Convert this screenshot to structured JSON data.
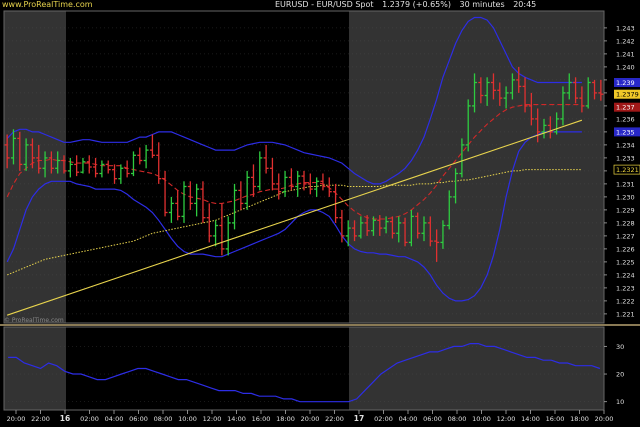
{
  "header": {
    "site": "www.ProRealTime.com",
    "instrument": "EURUSD - EUR/USD Spot",
    "price_change": "1.2379 (+0.65%)",
    "timeframe": "30 minutes",
    "time": "20:45"
  },
  "watermark": "© ProRealTime.com",
  "colors": {
    "up": "#2ecc40",
    "down": "#e03030",
    "bollinger": "#2d2de6",
    "ma": "#e8d44d",
    "trendline": "#e8d44d",
    "indicator": "#2d2de6",
    "mid_band": "#d02828",
    "grid": "#555555",
    "text": "#e0e0e0"
  },
  "chart_data": [
    {
      "type": "candlestick",
      "x_ticks": [
        "20:00",
        "22:00",
        "16",
        "02:00",
        "04:00",
        "06:00",
        "08:00",
        "10:00",
        "12:00",
        "14:00",
        "16:00",
        "18:00",
        "20:00",
        "22:00",
        "17",
        "02:00",
        "04:00",
        "06:00",
        "08:00",
        "10:00",
        "12:00",
        "14:00",
        "16:00",
        "18:00",
        "20:00"
      ],
      "y_ticks": [
        "1.243",
        "1.242",
        "1.241",
        "1.240",
        "1.239",
        "1.238",
        "1.237",
        "1.236",
        "1.235",
        "1.234",
        "1.233",
        "1.232",
        "1.231",
        "1.230",
        "1.229",
        "1.228",
        "1.227",
        "1.226",
        "1.225",
        "1.224",
        "1.223",
        "1.222",
        "1.221"
      ],
      "ylim": [
        1.2203,
        1.2443
      ],
      "price_labels": [
        {
          "text": "1.239",
          "value": 1.2388,
          "style": "blue"
        },
        {
          "text": "1.2379",
          "value": 1.2379,
          "style": "current"
        },
        {
          "text": "1.237",
          "value": 1.2369,
          "style": "red"
        },
        {
          "text": "1.235",
          "value": 1.235,
          "style": "blue"
        },
        {
          "text": "1.2321",
          "value": 1.2321,
          "style": "yellow"
        }
      ],
      "ohlc": [
        [
          1.234,
          1.2348,
          1.2322,
          1.233
        ],
        [
          1.233,
          1.2352,
          1.2325,
          1.2345
        ],
        [
          1.2345,
          1.235,
          1.232,
          1.2325
        ],
        [
          1.2325,
          1.2345,
          1.232,
          1.234
        ],
        [
          1.234,
          1.2345,
          1.2322,
          1.233
        ],
        [
          1.233,
          1.234,
          1.2318,
          1.2322
        ],
        [
          1.2322,
          1.2335,
          1.2315,
          1.233
        ],
        [
          1.233,
          1.2335,
          1.2318,
          1.2322
        ],
        [
          1.2322,
          1.2335,
          1.2318,
          1.2328
        ],
        [
          1.2328,
          1.2332,
          1.2318,
          1.232
        ],
        [
          1.232,
          1.233,
          1.2315,
          1.2325
        ],
        [
          1.2325,
          1.2332,
          1.2316,
          1.2319
        ],
        [
          1.2319,
          1.233,
          1.2318,
          1.2327
        ],
        [
          1.2327,
          1.2332,
          1.2318,
          1.2323
        ],
        [
          1.2323,
          1.233,
          1.2315,
          1.2318
        ],
        [
          1.2318,
          1.2328,
          1.2315,
          1.2325
        ],
        [
          1.2325,
          1.2328,
          1.2318,
          1.2321
        ],
        [
          1.2321,
          1.2325,
          1.231,
          1.2314
        ],
        [
          1.2314,
          1.2325,
          1.231,
          1.2322
        ],
        [
          1.2322,
          1.2328,
          1.2315,
          1.2318
        ],
        [
          1.2318,
          1.2335,
          1.2316,
          1.2332
        ],
        [
          1.2332,
          1.2338,
          1.2325,
          1.2328
        ],
        [
          1.2328,
          1.234,
          1.2322,
          1.2336
        ],
        [
          1.2336,
          1.2348,
          1.233,
          1.2332
        ],
        [
          1.2332,
          1.2342,
          1.231,
          1.2314
        ],
        [
          1.2314,
          1.232,
          1.2285,
          1.2288
        ],
        [
          1.2288,
          1.23,
          1.228,
          1.2295
        ],
        [
          1.2295,
          1.2305,
          1.2282,
          1.2285
        ],
        [
          1.2285,
          1.2312,
          1.228,
          1.2308
        ],
        [
          1.2308,
          1.2312,
          1.229,
          1.2295
        ],
        [
          1.2295,
          1.231,
          1.2285,
          1.2306
        ],
        [
          1.2306,
          1.2312,
          1.228,
          1.2284
        ],
        [
          1.2284,
          1.2295,
          1.2265,
          1.227
        ],
        [
          1.227,
          1.2282,
          1.2262,
          1.2278
        ],
        [
          1.2278,
          1.2295,
          1.2255,
          1.226
        ],
        [
          1.226,
          1.2285,
          1.2255,
          1.228
        ],
        [
          1.228,
          1.231,
          1.2275,
          1.2305
        ],
        [
          1.2305,
          1.2312,
          1.229,
          1.2295
        ],
        [
          1.2295,
          1.232,
          1.229,
          1.2315
        ],
        [
          1.2315,
          1.2325,
          1.23,
          1.2308
        ],
        [
          1.2308,
          1.2335,
          1.2305,
          1.233
        ],
        [
          1.233,
          1.234,
          1.2318,
          1.2322
        ],
        [
          1.2322,
          1.233,
          1.2305,
          1.231
        ],
        [
          1.231,
          1.2318,
          1.2298,
          1.2304
        ],
        [
          1.2304,
          1.232,
          1.23,
          1.2315
        ],
        [
          1.2315,
          1.2322,
          1.2305,
          1.2308
        ],
        [
          1.2308,
          1.232,
          1.23,
          1.2316
        ],
        [
          1.2316,
          1.232,
          1.2305,
          1.231
        ],
        [
          1.231,
          1.2318,
          1.2302,
          1.2306
        ],
        [
          1.2306,
          1.2315,
          1.23,
          1.2312
        ],
        [
          1.2312,
          1.2318,
          1.2305,
          1.2308
        ],
        [
          1.2308,
          1.2315,
          1.23,
          1.2304
        ],
        [
          1.2304,
          1.231,
          1.228,
          1.2284
        ],
        [
          1.2284,
          1.229,
          1.2265,
          1.227
        ],
        [
          1.227,
          1.2282,
          1.2262,
          1.2276
        ],
        [
          1.2276,
          1.2282,
          1.2266,
          1.227
        ],
        [
          1.227,
          1.2285,
          1.2268,
          1.228
        ],
        [
          1.228,
          1.2286,
          1.227,
          1.2274
        ],
        [
          1.2274,
          1.2285,
          1.227,
          1.2282
        ],
        [
          1.2282,
          1.2286,
          1.227,
          1.2276
        ],
        [
          1.2276,
          1.2285,
          1.2272,
          1.2281
        ],
        [
          1.2281,
          1.2285,
          1.2268,
          1.2272
        ],
        [
          1.2272,
          1.2285,
          1.2265,
          1.228
        ],
        [
          1.228,
          1.2284,
          1.2262,
          1.2265
        ],
        [
          1.2265,
          1.229,
          1.2262,
          1.2285
        ],
        [
          1.2285,
          1.2288,
          1.2268,
          1.2272
        ],
        [
          1.2272,
          1.2285,
          1.2266,
          1.228
        ],
        [
          1.228,
          1.2285,
          1.2262,
          1.2266
        ],
        [
          1.2266,
          1.2275,
          1.225,
          1.2265
        ],
        [
          1.2265,
          1.2282,
          1.226,
          1.2278
        ],
        [
          1.2278,
          1.2305,
          1.2275,
          1.23
        ],
        [
          1.23,
          1.2322,
          1.2295,
          1.2318
        ],
        [
          1.2318,
          1.2345,
          1.2315,
          1.234
        ],
        [
          1.234,
          1.2375,
          1.2335,
          1.237
        ],
        [
          1.237,
          1.2395,
          1.2365,
          1.2388
        ],
        [
          1.2388,
          1.2392,
          1.2372,
          1.2378
        ],
        [
          1.2378,
          1.2392,
          1.237,
          1.2388
        ],
        [
          1.2388,
          1.2395,
          1.2375,
          1.2382
        ],
        [
          1.2382,
          1.2388,
          1.237,
          1.2376
        ],
        [
          1.2376,
          1.2385,
          1.2368,
          1.238
        ],
        [
          1.238,
          1.2395,
          1.2375,
          1.239
        ],
        [
          1.239,
          1.24,
          1.238,
          1.2385
        ],
        [
          1.2385,
          1.2392,
          1.2365,
          1.237
        ],
        [
          1.237,
          1.238,
          1.2355,
          1.236
        ],
        [
          1.236,
          1.2368,
          1.2342,
          1.235
        ],
        [
          1.235,
          1.236,
          1.2345,
          1.2355
        ],
        [
          1.2355,
          1.2362,
          1.2345,
          1.235
        ],
        [
          1.235,
          1.2365,
          1.2348,
          1.236
        ],
        [
          1.236,
          1.2385,
          1.2355,
          1.238
        ],
        [
          1.238,
          1.2395,
          1.2375,
          1.2388
        ],
        [
          1.2388,
          1.2392,
          1.2372,
          1.2376
        ],
        [
          1.2376,
          1.2385,
          1.2365,
          1.237
        ],
        [
          1.237,
          1.2392,
          1.2368,
          1.2388
        ],
        [
          1.2388,
          1.239,
          1.2375,
          1.238
        ],
        [
          1.238,
          1.239,
          1.2374,
          1.2379
        ]
      ],
      "bollinger_upper": [
        1.2345,
        1.235,
        1.2352,
        1.2352,
        1.235,
        1.235,
        1.2348,
        1.2346,
        1.2344,
        1.2342,
        1.2342,
        1.2343,
        1.2344,
        1.2344,
        1.2343,
        1.2342,
        1.2342,
        1.2342,
        1.2342,
        1.2342,
        1.2344,
        1.2346,
        1.2346,
        1.2348,
        1.235,
        1.235,
        1.235,
        1.2348,
        1.2346,
        1.2344,
        1.2342,
        1.234,
        1.2338,
        1.2336,
        1.2336,
        1.2336,
        1.2336,
        1.2338,
        1.234,
        1.2341,
        1.2342,
        1.2342,
        1.2342,
        1.2341,
        1.234,
        1.2338,
        1.2336,
        1.2334,
        1.2333,
        1.2332,
        1.2331,
        1.233,
        1.2328,
        1.2326,
        1.2322,
        1.2318,
        1.2315,
        1.2312,
        1.231,
        1.231,
        1.2312,
        1.2315,
        1.2318,
        1.2322,
        1.2328,
        1.2336,
        1.2346,
        1.236,
        1.2375,
        1.2392,
        1.2405,
        1.2418,
        1.2428,
        1.2435,
        1.2438,
        1.2438,
        1.2436,
        1.243,
        1.242,
        1.241,
        1.24,
        1.2395,
        1.2392,
        1.239,
        1.2388,
        1.2388,
        1.2388,
        1.2388,
        1.2388,
        1.2388,
        1.2388,
        1.2388
      ],
      "bollinger_lower": [
        1.225,
        1.226,
        1.2275,
        1.229,
        1.23,
        1.2306,
        1.231,
        1.2312,
        1.2312,
        1.2312,
        1.2312,
        1.231,
        1.2309,
        1.2308,
        1.2306,
        1.2306,
        1.2306,
        1.2306,
        1.2305,
        1.2302,
        1.2298,
        1.2295,
        1.2292,
        1.2288,
        1.2282,
        1.2275,
        1.2268,
        1.2262,
        1.2258,
        1.2256,
        1.2256,
        1.2256,
        1.2255,
        1.2254,
        1.2254,
        1.2256,
        1.2258,
        1.226,
        1.2262,
        1.2264,
        1.2266,
        1.2268,
        1.227,
        1.2272,
        1.2275,
        1.228,
        1.2285,
        1.2288,
        1.229,
        1.229,
        1.2288,
        1.2285,
        1.2278,
        1.227,
        1.2264,
        1.226,
        1.2258,
        1.2257,
        1.2257,
        1.2256,
        1.2256,
        1.2255,
        1.2254,
        1.2254,
        1.2252,
        1.225,
        1.2246,
        1.224,
        1.2232,
        1.2226,
        1.2222,
        1.222,
        1.222,
        1.2221,
        1.2224,
        1.223,
        1.224,
        1.2255,
        1.2275,
        1.23,
        1.232,
        1.2335,
        1.2342,
        1.2346,
        1.2348,
        1.235,
        1.235,
        1.235,
        1.235,
        1.235,
        1.235,
        1.235
      ],
      "mid_band": [
        1.23,
        1.231,
        1.2318,
        1.2322,
        1.2326,
        1.2328,
        1.2328,
        1.2329,
        1.2328,
        1.2328,
        1.2327,
        1.2326,
        1.2326,
        1.2326,
        1.2325,
        1.2324,
        1.2324,
        1.2324,
        1.2324,
        1.2322,
        1.2321,
        1.232,
        1.2319,
        1.2318,
        1.2316,
        1.2313,
        1.2309,
        1.2305,
        1.2302,
        1.23,
        1.2299,
        1.2298,
        1.2296,
        1.2295,
        1.2295,
        1.2296,
        1.2297,
        1.2299,
        1.2301,
        1.2302,
        1.2304,
        1.2305,
        1.2306,
        1.2306,
        1.2307,
        1.2309,
        1.231,
        1.2311,
        1.2311,
        1.2311,
        1.231,
        1.2307,
        1.2303,
        1.2298,
        1.2293,
        1.2289,
        1.2286,
        1.2284,
        1.2283,
        1.2283,
        1.2283,
        1.2284,
        1.2285,
        1.2287,
        1.229,
        1.2294,
        1.2298,
        1.2303,
        1.2309,
        1.2316,
        1.2322,
        1.2328,
        1.2334,
        1.234,
        1.2346,
        1.2351,
        1.2356,
        1.236,
        1.2364,
        1.2367,
        1.2369,
        1.237,
        1.2371,
        1.2371,
        1.2371,
        1.2371,
        1.2371,
        1.2371,
        1.2371,
        1.2371,
        1.2371,
        1.2371
      ],
      "moving_average": [
        1.224,
        1.2242,
        1.2244,
        1.2246,
        1.2248,
        1.225,
        1.2252,
        1.2253,
        1.2254,
        1.2255,
        1.2256,
        1.2257,
        1.2258,
        1.2259,
        1.226,
        1.2261,
        1.2262,
        1.2263,
        1.2264,
        1.2265,
        1.2266,
        1.2268,
        1.227,
        1.2272,
        1.2273,
        1.2274,
        1.2275,
        1.2276,
        1.2277,
        1.2278,
        1.2279,
        1.228,
        1.2281,
        1.2282,
        1.2284,
        1.2286,
        1.2288,
        1.229,
        1.2292,
        1.2294,
        1.2296,
        1.2298,
        1.23,
        1.2302,
        1.2304,
        1.2305,
        1.2306,
        1.2307,
        1.2308,
        1.2308,
        1.2309,
        1.2309,
        1.2309,
        1.2309,
        1.2308,
        1.2308,
        1.2308,
        1.2308,
        1.2308,
        1.2308,
        1.2309,
        1.2309,
        1.2309,
        1.2309,
        1.2309,
        1.231,
        1.231,
        1.231,
        1.2311,
        1.2311,
        1.2312,
        1.2312,
        1.2313,
        1.2313,
        1.2314,
        1.2315,
        1.2316,
        1.2317,
        1.2318,
        1.2319,
        1.232,
        1.232,
        1.2321,
        1.2321,
        1.2321,
        1.2321,
        1.2321,
        1.2321,
        1.2321,
        1.2321,
        1.2321,
        1.2321
      ],
      "trendline": [
        [
          0,
          1.2209
        ],
        [
          91,
          1.2359
        ]
      ]
    },
    {
      "type": "line",
      "y_ticks": [
        "30",
        "20",
        "10"
      ],
      "ylim": [
        7,
        37
      ],
      "values": [
        26,
        26,
        24,
        23,
        22,
        24,
        23,
        21,
        20,
        20,
        19,
        18,
        18,
        19,
        20,
        21,
        22,
        22,
        21,
        20,
        19,
        18,
        18,
        17,
        16,
        15,
        14,
        14,
        14,
        13,
        13,
        12,
        12,
        12,
        11,
        11,
        10,
        10,
        10,
        10,
        10,
        10,
        10,
        11,
        14,
        17,
        20,
        22,
        24,
        25,
        26,
        27,
        28,
        28,
        29,
        30,
        30,
        31,
        31,
        30,
        30,
        29,
        28,
        27,
        26,
        26,
        25,
        25,
        24,
        24,
        23,
        23,
        23,
        22
      ]
    }
  ]
}
